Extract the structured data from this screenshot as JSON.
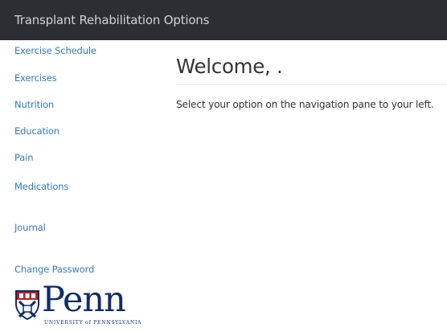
{
  "header": {
    "title": "Transplant Rehabilitation Options"
  },
  "sidebar": {
    "items": [
      {
        "label": "Exercise Schedule"
      },
      {
        "label": "Exercises"
      },
      {
        "label": "Nutrition"
      },
      {
        "label": "Education"
      },
      {
        "label": "Pain"
      },
      {
        "label": "Medications"
      },
      {
        "label": "Journal"
      },
      {
        "label": "Change Password"
      }
    ],
    "logo": {
      "wordmark": "Penn",
      "subtitle": "UNIVERSITY of PENNSYLVANIA",
      "icon": "shield-icon"
    }
  },
  "main": {
    "welcome": "Welcome, .",
    "instructions": "Select your option on the navigation pane to your left."
  },
  "colors": {
    "header_bg": "#2b2f33",
    "header_text": "#cfd3d6",
    "link": "#337ab7",
    "penn_blue": "#0f2c6a",
    "penn_red": "#b41f24",
    "body_text": "#333333"
  }
}
